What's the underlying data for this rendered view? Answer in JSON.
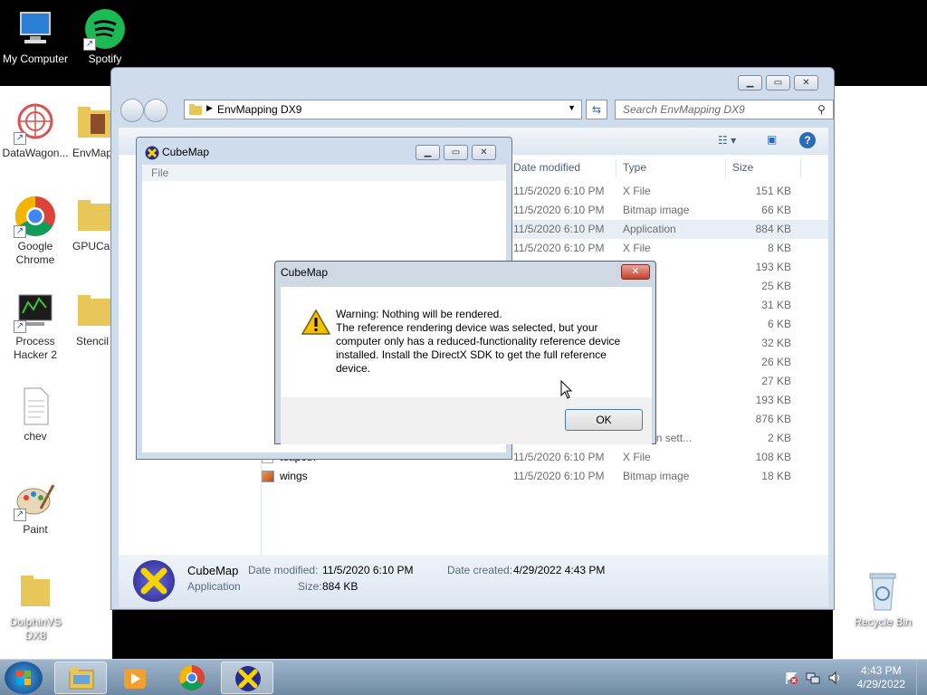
{
  "desktop": {
    "icons": [
      {
        "label": "My Computer"
      },
      {
        "label": "Spotify"
      },
      {
        "label": "DataWagon..."
      },
      {
        "label": "EnvMap DX"
      },
      {
        "label": "Google Chrome"
      },
      {
        "label": "GPUCap"
      },
      {
        "label": "Process Hacker 2"
      },
      {
        "label": "Stencil"
      },
      {
        "label": "chev"
      },
      {
        "label": "Paint"
      },
      {
        "label": "DolphinVS DX8"
      },
      {
        "label": "Recycle Bin"
      }
    ]
  },
  "explorer": {
    "address": "EnvMapping DX9",
    "search_placeholder": "Search EnvMapping DX9",
    "columns": [
      "Date modified",
      "Type",
      "Size"
    ],
    "rows": [
      {
        "name": "",
        "date": "11/5/2020 6:10 PM",
        "type": "X File",
        "size": "151 KB"
      },
      {
        "name": "",
        "date": "11/5/2020 6:10 PM",
        "type": "Bitmap image",
        "size": "66 KB"
      },
      {
        "name": "",
        "date": "11/5/2020 6:10 PM",
        "type": "Application",
        "size": "884 KB"
      },
      {
        "name": "",
        "date": "11/5/2020 6:10 PM",
        "type": "X File",
        "size": "8 KB"
      },
      {
        "name": "",
        "date": "",
        "type": "",
        "size": "193 KB"
      },
      {
        "name": "",
        "date": "",
        "type": "image",
        "size": "25 KB"
      },
      {
        "name": "",
        "date": "",
        "type": "image",
        "size": "31 KB"
      },
      {
        "name": "",
        "date": "",
        "type": "image",
        "size": "6 KB"
      },
      {
        "name": "",
        "date": "",
        "type": "image",
        "size": "32 KB"
      },
      {
        "name": "",
        "date": "",
        "type": "image",
        "size": "26 KB"
      },
      {
        "name": "",
        "date": "",
        "type": "image",
        "size": "27 KB"
      },
      {
        "name": "",
        "date": "",
        "type": "image",
        "size": "193 KB"
      },
      {
        "name": "",
        "date": "",
        "type": "tion",
        "size": "876 KB"
      },
      {
        "name": "",
        "date": "",
        "type": "guration sett...",
        "size": "2 KB"
      },
      {
        "name": "teapotx",
        "date": "11/5/2020 6:10 PM",
        "type": "X File",
        "size": "108 KB"
      },
      {
        "name": "wings",
        "date": "11/5/2020 6:10 PM",
        "type": "Bitmap image",
        "size": "18 KB"
      }
    ],
    "details": {
      "name": "CubeMap",
      "kind": "Application",
      "modified_label": "Date modified:",
      "modified_value": "11/5/2020 6:10 PM",
      "created_label": "Date created:",
      "created_value": "4/29/2022 4:43 PM",
      "size_label": "Size:",
      "size_value": "884 KB"
    }
  },
  "cubemap_window": {
    "title": "CubeMap",
    "menu_file": "File"
  },
  "dialog": {
    "title": "CubeMap",
    "close": "✕",
    "message_line1": "Warning: Nothing will be rendered.",
    "message_line2": "The reference rendering device was selected, but your computer only has a reduced-functionality reference device installed.  Install the DirectX SDK to get the full reference device.",
    "ok_label": "OK"
  },
  "taskbar": {
    "time": "4:43 PM",
    "date": "4/29/2022"
  },
  "colors": {
    "window_frame": "#cfdceb",
    "taskbar": "#6f8aa5",
    "close_red": "#c4412f"
  }
}
